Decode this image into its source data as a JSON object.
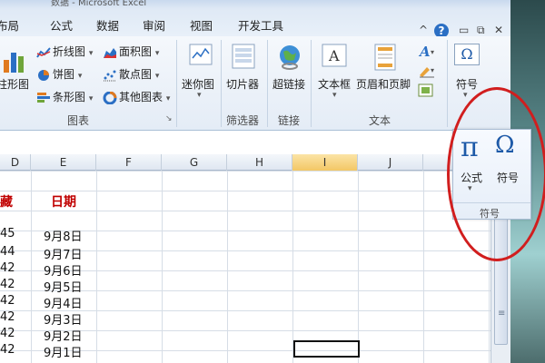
{
  "window": {
    "title_fragment": "数据 - Microsoft Excel"
  },
  "tabs": [
    "布局",
    "公式",
    "数据",
    "审阅",
    "视图",
    "开发工具"
  ],
  "window_controls": {
    "minimize_ribbon": "^",
    "help": "?",
    "minimize": "▭",
    "restore": "⧉",
    "close": "✕"
  },
  "ribbon": {
    "charts": {
      "bar_partial": "柱形图",
      "line": "折线图",
      "pie": "饼图",
      "barh": "条形图",
      "area": "面积图",
      "scatter": "散点图",
      "other": "其他图表",
      "group_label": "图表",
      "dialog_launcher": "↘"
    },
    "sparklines": {
      "label": "迷你图",
      "group_label": ""
    },
    "filter": {
      "slicer": "切片器",
      "group_label": "筛选器"
    },
    "links": {
      "hyperlink": "超链接",
      "group_label": "链接"
    },
    "text": {
      "textbox": "文本框",
      "header_footer": "页眉和页脚",
      "group_label": "文本"
    },
    "symbols_small": {
      "label": "符号"
    }
  },
  "popout": {
    "equation_label": "公式",
    "symbol_label": "符号",
    "group_label": "符号",
    "pi_glyph": "π",
    "omega_glyph": "Ω"
  },
  "sheet": {
    "columns": [
      "D",
      "E",
      "F",
      "G",
      "H",
      "I",
      "J"
    ],
    "selected_column": "I",
    "header_row": {
      "d": "藏",
      "e": "日期"
    },
    "rows": [
      {
        "d": "45",
        "e": "9月8日"
      },
      {
        "d": "44",
        "e": "9月7日"
      },
      {
        "d": "42",
        "e": "9月6日"
      },
      {
        "d": "42",
        "e": "9月5日"
      },
      {
        "d": "42",
        "e": "9月4日"
      },
      {
        "d": "42",
        "e": "9月3日"
      },
      {
        "d": "42",
        "e": "9月2日"
      },
      {
        "d": "42",
        "e": "9月1日"
      }
    ]
  },
  "colors": {
    "header_red": "#c00000",
    "accent_blue": "#1e5aa8",
    "highlight_ellipse": "#d11e1e"
  }
}
